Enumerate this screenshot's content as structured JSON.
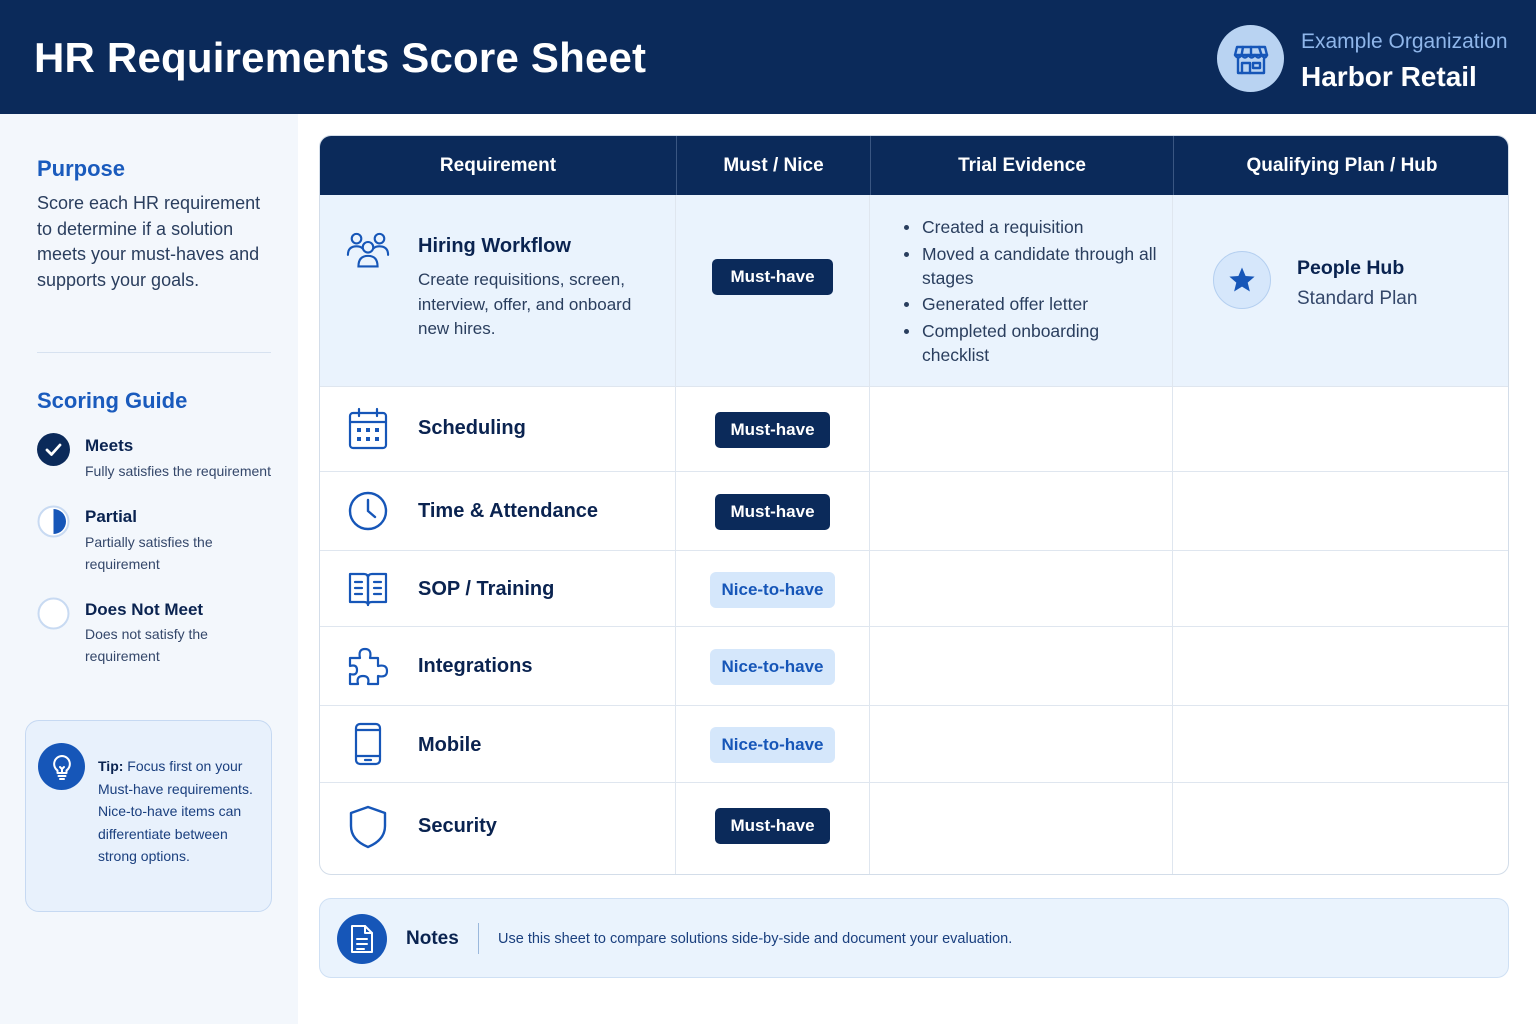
{
  "header": {
    "title": "HR Requirements Score Sheet",
    "org_label": "Example Organization",
    "org_name": "Harbor Retail",
    "org_icon": "storefront-icon"
  },
  "sidebar": {
    "purpose_heading": "Purpose",
    "purpose_text": "Score each HR requirement to determine if a solution meets your must-haves and supports your goals.",
    "scoring_heading": "Scoring Guide",
    "guide": [
      {
        "label": "Meets",
        "desc": "Fully satisfies the requirement",
        "icon": "check-circle-icon"
      },
      {
        "label": "Partial",
        "desc": "Partially satisfies the requirement",
        "icon": "half-circle-icon"
      },
      {
        "label": "Does Not Meet",
        "desc": "Does not satisfy the requirement",
        "icon": "empty-circle-icon"
      }
    ],
    "tip_label": "Tip:",
    "tip_text": "Focus first on your Must-have requirements. Nice-to-have items can differentiate between strong options.",
    "tip_icon": "lightbulb-icon"
  },
  "table": {
    "headers": [
      "Requirement",
      "Must / Nice",
      "Trial Evidence",
      "Qualifying Plan / Hub"
    ],
    "rows": [
      {
        "name": "Hiring Workflow",
        "desc": "Create requisitions, screen, interview, offer, and onboard new hires.",
        "priority": "Must-have",
        "icon": "people-icon",
        "evidence": [
          "Created a requisition",
          "Moved a candidate through all stages",
          "Generated offer letter",
          "Completed onboarding checklist"
        ],
        "plan_name": "People Hub",
        "plan_tier": "Standard Plan",
        "plan_icon": "star-icon"
      },
      {
        "name": "Scheduling",
        "priority": "Must-have",
        "icon": "calendar-icon"
      },
      {
        "name": "Time & Attendance",
        "priority": "Must-have",
        "icon": "clock-icon"
      },
      {
        "name": "SOP / Training",
        "priority": "Nice-to-have",
        "icon": "book-icon"
      },
      {
        "name": "Integrations",
        "priority": "Nice-to-have",
        "icon": "puzzle-icon"
      },
      {
        "name": "Mobile",
        "priority": "Nice-to-have",
        "icon": "mobile-icon"
      },
      {
        "name": "Security",
        "priority": "Must-have",
        "icon": "shield-icon"
      }
    ]
  },
  "notes": {
    "label": "Notes",
    "text": "Use this sheet to compare solutions side-by-side and document your evaluation.",
    "icon": "document-icon"
  },
  "colors": {
    "navy": "#0b2a5a",
    "accent_blue": "#1656b8",
    "light_blue": "#eaf3fd",
    "nice_badge": "#d5e7fb"
  }
}
